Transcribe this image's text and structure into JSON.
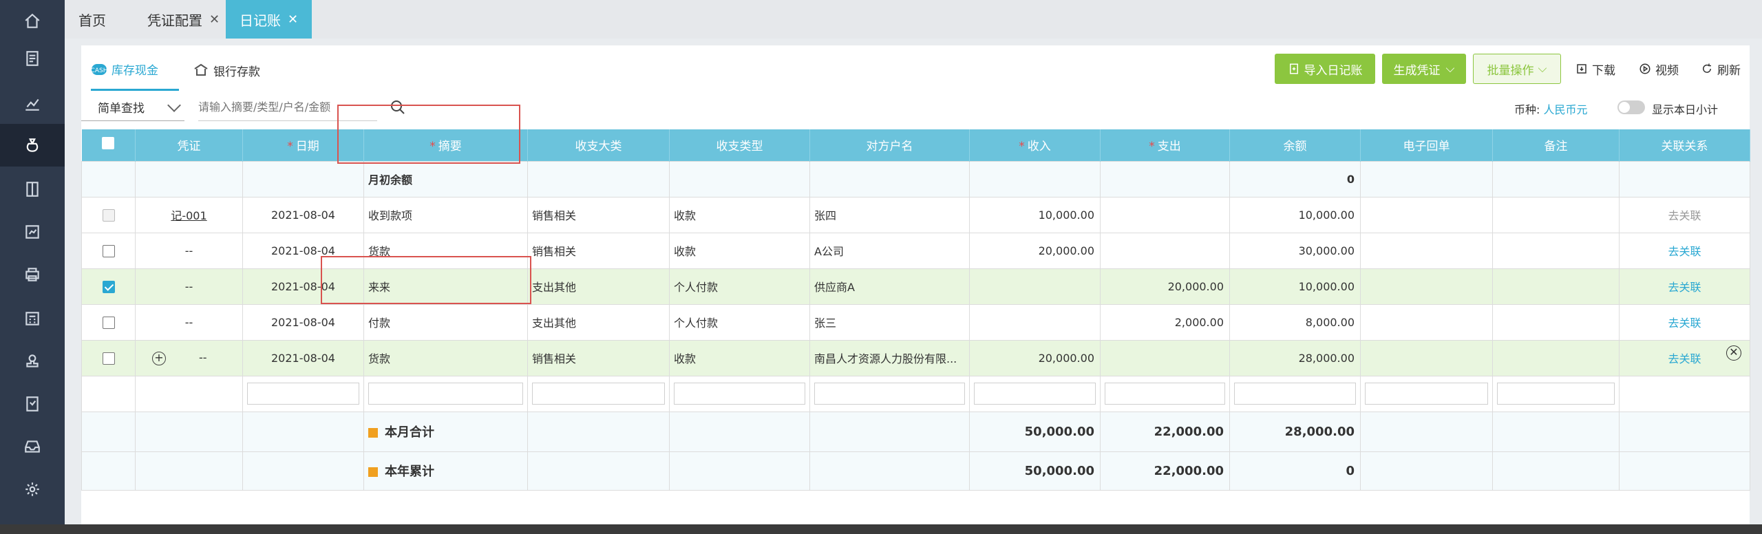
{
  "tabs": [
    {
      "label": "首页",
      "closable": false
    },
    {
      "label": "凭证配置",
      "closable": true
    },
    {
      "label": "日记账",
      "closable": true,
      "active": true
    }
  ],
  "subtabs": [
    {
      "label": "库存现金",
      "active": true
    },
    {
      "label": "银行存款",
      "active": false
    }
  ],
  "toolbar": {
    "import_label": "导入日记账",
    "generate_label": "生成凭证",
    "batch_label": "批量操作",
    "download_label": "下载",
    "video_label": "视频",
    "refresh_label": "刷新"
  },
  "search": {
    "mode": "简单查找",
    "placeholder": "请输入摘要/类型/户名/金额"
  },
  "currency": {
    "label": "币种:",
    "value": "人民币元"
  },
  "daily_subtotal_label": "显示本日小计",
  "columns": [
    "凭证",
    "日期",
    "摘要",
    "收支大类",
    "收支类型",
    "对方户名",
    "收入",
    "支出",
    "余额",
    "电子回单",
    "备注",
    "关联关系"
  ],
  "opening": {
    "label": "月初余额",
    "balance": "0"
  },
  "rows": [
    {
      "voucher": "记-001",
      "date": "2021-08-04",
      "summary": "收到款项",
      "category": "销售相关",
      "type": "收款",
      "party": "张四",
      "income": "10,000.00",
      "expense": "",
      "balance": "10,000.00",
      "relation": "去关联"
    },
    {
      "voucher": "--",
      "date": "2021-08-04",
      "summary": "货款",
      "category": "销售相关",
      "type": "收款",
      "party": "A公司",
      "income": "20,000.00",
      "expense": "",
      "balance": "30,000.00",
      "relation": "去关联"
    },
    {
      "voucher": "--",
      "date": "2021-08-04",
      "summary": "来来",
      "category": "支出其他",
      "type": "个人付款",
      "party": "供应商A",
      "income": "",
      "expense": "20,000.00",
      "balance": "10,000.00",
      "relation": "去关联"
    },
    {
      "voucher": "--",
      "date": "2021-08-04",
      "summary": "付款",
      "category": "支出其他",
      "type": "个人付款",
      "party": "张三",
      "income": "",
      "expense": "2,000.00",
      "balance": "8,000.00",
      "relation": "去关联"
    },
    {
      "voucher": "--",
      "date": "2021-08-04",
      "summary": "货款",
      "category": "销售相关",
      "type": "收款",
      "party": "南昌人才资源人力股份有限...",
      "income": "20,000.00",
      "expense": "",
      "balance": "28,000.00",
      "relation": "去关联"
    }
  ],
  "month_total": {
    "label": "本月合计",
    "income": "50,000.00",
    "expense": "22,000.00",
    "balance": "28,000.00"
  },
  "year_total": {
    "label": "本年累计",
    "income": "50,000.00",
    "expense": "22,000.00",
    "balance": "0"
  },
  "colors": {
    "header": "#6bc3dc",
    "accent": "#2aa8d2",
    "green_btn": "#8cc63f",
    "rail": "#2f3a4c"
  }
}
